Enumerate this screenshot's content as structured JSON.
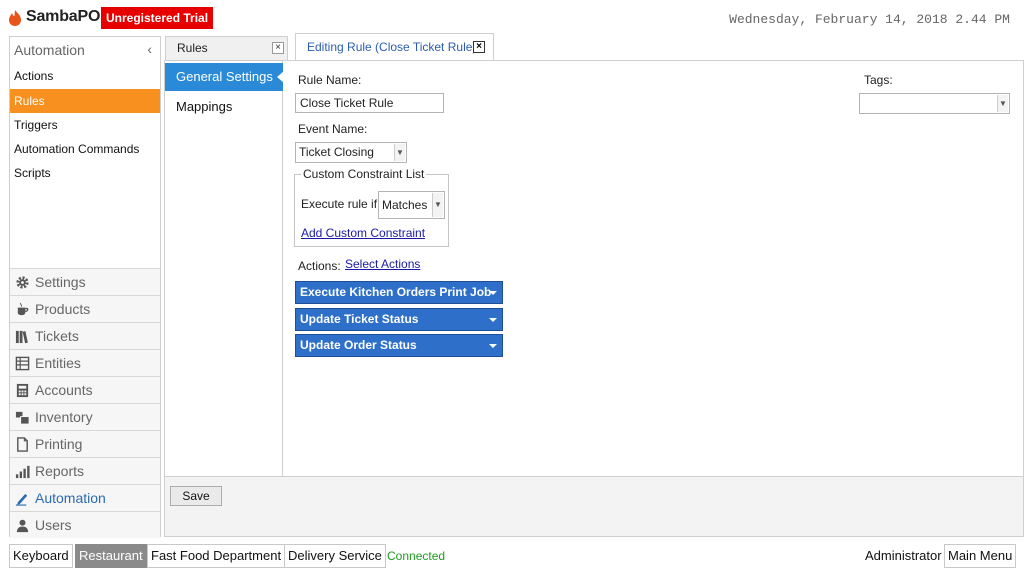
{
  "header": {
    "app_name": "SambaPOS",
    "trial_badge": "Unregistered Trial",
    "datetime": "Wednesday, February 14, 2018 2.44 PM",
    "logo_icon": "flame-icon"
  },
  "sidebar": {
    "title": "Automation",
    "collapse_glyph": "‹",
    "items": [
      {
        "label": "Actions"
      },
      {
        "label": "Rules",
        "active": true
      },
      {
        "label": "Triggers"
      },
      {
        "label": "Automation Commands"
      },
      {
        "label": "Scripts"
      }
    ],
    "modules": [
      {
        "label": "Settings",
        "icon": "gear-icon"
      },
      {
        "label": "Products",
        "icon": "coffee-cup-icon"
      },
      {
        "label": "Tickets",
        "icon": "books-icon"
      },
      {
        "label": "Entities",
        "icon": "table-icon"
      },
      {
        "label": "Accounts",
        "icon": "calculator-icon"
      },
      {
        "label": "Inventory",
        "icon": "boxes-icon"
      },
      {
        "label": "Printing",
        "icon": "document-icon"
      },
      {
        "label": "Reports",
        "icon": "bar-chart-icon"
      },
      {
        "label": "Automation",
        "icon": "pencil-icon",
        "active": true
      },
      {
        "label": "Users",
        "icon": "user-icon"
      }
    ]
  },
  "tabs": {
    "rules_label": "Rules",
    "editing_label": "Editing Rule (Close Ticket Rule)",
    "close_glyph": "×"
  },
  "settings_nav": {
    "general": "General Settings",
    "mappings": "Mappings"
  },
  "form": {
    "rule_name_label": "Rule Name:",
    "rule_name_value": "Close Ticket Rule",
    "event_name_label": "Event Name:",
    "event_name_value": "Ticket Closing",
    "tags_label": "Tags:",
    "tags_value": "",
    "constraint_legend": "Custom Constraint List",
    "execute_rule_label": "Execute rule if",
    "execute_rule_value": "Matches",
    "add_constraint_link": "Add Custom Constraint",
    "actions_label": "Actions:",
    "select_actions_link": "Select Actions",
    "actions": [
      "Execute Kitchen Orders Print Job",
      "Update Ticket Status",
      "Update Order Status"
    ],
    "save_label": "Save"
  },
  "bottom_bar": {
    "keyboard": "Keyboard",
    "restaurant": "Restaurant",
    "fast_food": "Fast Food Department",
    "delivery": "Delivery Service",
    "status": "Connected",
    "user": "Administrator",
    "main_menu": "Main Menu"
  },
  "colors": {
    "accent_orange": "#f7901e",
    "accent_blue": "#2b8ad8",
    "action_blue": "#2e70c9",
    "trial_red": "#e60000",
    "status_green": "#1f9a1f"
  }
}
